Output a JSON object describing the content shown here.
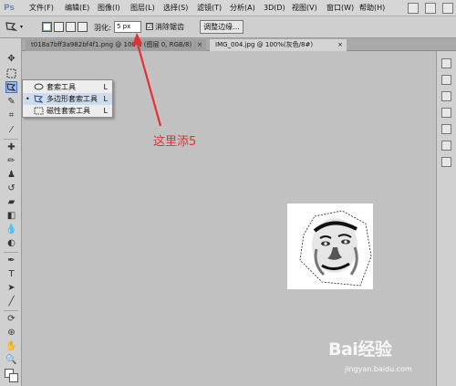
{
  "app": {
    "logo": "Ps"
  },
  "menubar": {
    "items": [
      "文件(F)",
      "编辑(E)",
      "图像(I)",
      "图层(L)",
      "选择(S)",
      "滤镜(T)",
      "分析(A)",
      "3D(D)",
      "视图(V)",
      "窗口(W)",
      "帮助(H)"
    ]
  },
  "options": {
    "feather_label": "羽化:",
    "feather_value": "5 px",
    "antialias_check": "☑",
    "antialias_label": "消除锯齿",
    "refine_edge_label": "调整边缘..."
  },
  "tabs": [
    {
      "label": "t018a7bff3a982bf4f1.png @ 100% (图层 0, RGB/8)",
      "close": "×"
    },
    {
      "label": "IMG_004.jpg @ 100%(灰色/8#)",
      "close": "×"
    }
  ],
  "flyout": {
    "items": [
      {
        "label": "套索工具",
        "key": "L",
        "selected": false
      },
      {
        "label": "多边形套索工具",
        "key": "L",
        "selected": true
      },
      {
        "label": "磁性套索工具",
        "key": "L",
        "selected": false
      }
    ]
  },
  "annotation": {
    "text": "这里添5",
    "color": "#e43030"
  },
  "colors": {
    "foreground": "#ffffff",
    "background": "#ffffff",
    "accent": "#4a72b8"
  },
  "watermark": {
    "brand": "Bai经验",
    "url": "jingyan.baidu.com"
  }
}
